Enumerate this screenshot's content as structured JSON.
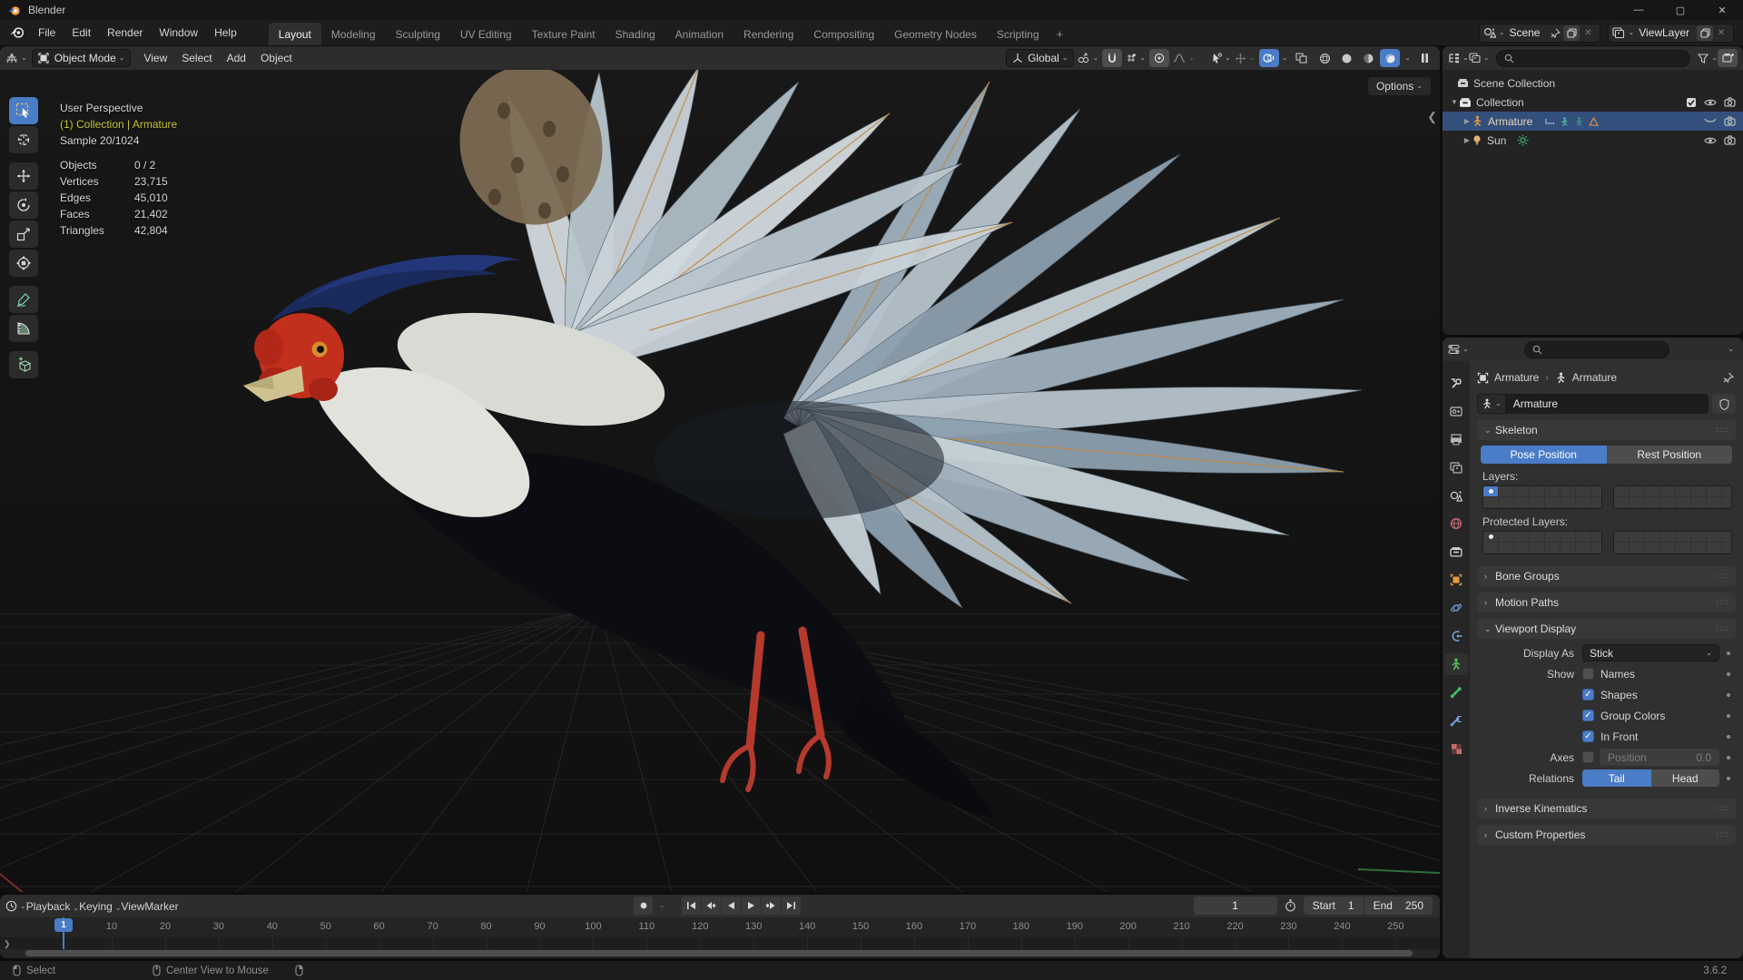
{
  "colors": {
    "accent": "#4a7cc7",
    "selection_row": "#33507c",
    "info_yellow": "#c9c933"
  },
  "titlebar": {
    "app_title": "Blender"
  },
  "menubar": {
    "menus": [
      "File",
      "Edit",
      "Render",
      "Window",
      "Help"
    ]
  },
  "workspaces": {
    "active": "Layout",
    "tabs": [
      "Layout",
      "Modeling",
      "Sculpting",
      "UV Editing",
      "Texture Paint",
      "Shading",
      "Animation",
      "Rendering",
      "Compositing",
      "Geometry Nodes",
      "Scripting"
    ],
    "add_label": "+"
  },
  "scene_widget": {
    "value": "Scene"
  },
  "viewlayer_widget": {
    "value": "ViewLayer"
  },
  "viewport": {
    "header": {
      "mode": "Object Mode",
      "menus": [
        "View",
        "Select",
        "Add",
        "Object"
      ],
      "orientation": "Global",
      "options_label": "Options"
    },
    "overlay": {
      "perspective": "User Perspective",
      "context": "(1) Collection | Armature",
      "sample": "Sample 20/1024",
      "stats": [
        {
          "label": "Objects",
          "value": "0 / 2"
        },
        {
          "label": "Vertices",
          "value": "23,715"
        },
        {
          "label": "Edges",
          "value": "45,010"
        },
        {
          "label": "Faces",
          "value": "21,402"
        },
        {
          "label": "Triangles",
          "value": "42,804"
        }
      ]
    }
  },
  "outliner": {
    "scene_collection": "Scene Collection",
    "collection": "Collection",
    "armature": "Armature",
    "sun": "Sun"
  },
  "properties": {
    "breadcrumb_object": "Armature",
    "breadcrumb_data": "Armature",
    "name_value": "Armature",
    "skeleton": {
      "title": "Skeleton",
      "pose_label": "Pose Position",
      "rest_label": "Rest Position",
      "active_position": "Pose Position",
      "layers_label": "Layers:",
      "protected_label": "Protected Layers:"
    },
    "sections": {
      "bone_groups": "Bone Groups",
      "motion_paths": "Motion Paths",
      "viewport_display": "Viewport Display",
      "inverse_kinematics": "Inverse Kinematics",
      "custom_properties": "Custom Properties"
    },
    "viewport_display": {
      "display_as_label": "Display As",
      "display_as_value": "Stick",
      "show_label": "Show",
      "checkboxes": [
        {
          "label": "Names",
          "checked": false
        },
        {
          "label": "Shapes",
          "checked": true
        },
        {
          "label": "Group Colors",
          "checked": true
        },
        {
          "label": "In Front",
          "checked": true
        }
      ],
      "axes_label": "Axes",
      "axes_checked": false,
      "position_label": "Position",
      "position_value": "0.0",
      "relations_label": "Relations",
      "relations_options": [
        "Tail",
        "Head"
      ],
      "relations_active": "Tail"
    }
  },
  "timeline": {
    "menus": [
      "Playback",
      "Keying",
      "View",
      "Marker"
    ],
    "current_frame": "1",
    "ruler_frames": [
      10,
      20,
      30,
      40,
      50,
      60,
      70,
      80,
      90,
      100,
      110,
      120,
      130,
      140,
      150,
      160,
      170,
      180,
      190,
      200,
      210,
      220,
      230,
      240,
      250
    ],
    "start_label": "Start",
    "start_value": "1",
    "end_label": "End",
    "end_value": "250"
  },
  "statusbar": {
    "hint_left": "Select",
    "hint_middle": "Center View to Mouse",
    "version": "3.6.2"
  }
}
